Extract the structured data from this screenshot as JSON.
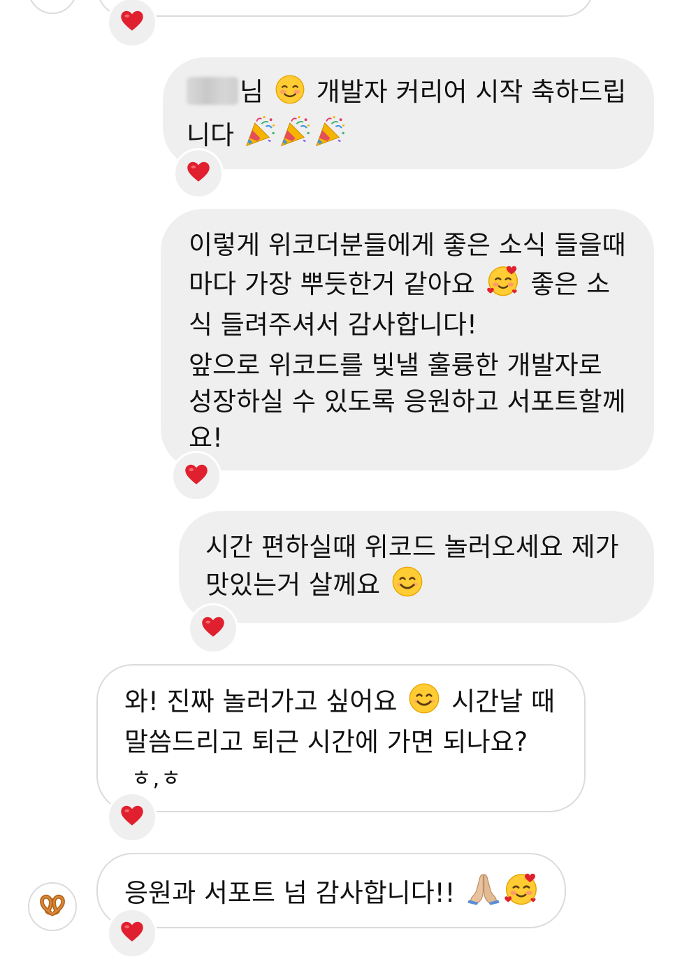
{
  "conversation": {
    "messages": [
      {
        "id": "m1",
        "side": "sent",
        "lines": [
          "님",
          "개발자 커리어 시작 축하드립",
          "니다"
        ],
        "reaction": "red-heart"
      },
      {
        "id": "m2",
        "side": "sent",
        "paragraph1": [
          "이렇게 위코더분들에게 좋은 소식 들을때",
          "마다 가장 뿌듯한거 같아요",
          "좋은 소",
          "식 들려주셔서 감사합니다!"
        ],
        "paragraph2": [
          "앞으로 위코드를 빛낼 훌륭한 개발자로",
          "성장하실 수 있도록 응원하고 서포트할께",
          "요!"
        ],
        "reaction": "red-heart"
      },
      {
        "id": "m3",
        "side": "sent",
        "lines": [
          "시간 편하실때 위코드 놀러오세요 제가",
          "맛있는거 살께요"
        ],
        "reaction": "red-heart"
      },
      {
        "id": "m4",
        "side": "received",
        "lines": [
          "와! 진짜 놀러가고 싶어요",
          "시간날 때",
          "말씀드리고 퇴근 시간에 가면 되나요?",
          "ㅎ,ㅎ"
        ],
        "reaction": "red-heart"
      },
      {
        "id": "m5",
        "side": "received",
        "lines": [
          "응원과 서포트 넘 감사합니다!!"
        ],
        "reaction": "red-heart"
      }
    ]
  },
  "icons": {
    "reaction": "red-heart-icon",
    "avatar": "pretzel-icon",
    "party": "party-popper-icon",
    "smile": "smiling-face-icon",
    "hearts": "smiling-face-with-hearts-icon",
    "pray": "folded-hands-icon"
  },
  "colors": {
    "sent_bubble": "#efefef",
    "received_border": "#dbdbdb",
    "heart": "#e0202e"
  }
}
